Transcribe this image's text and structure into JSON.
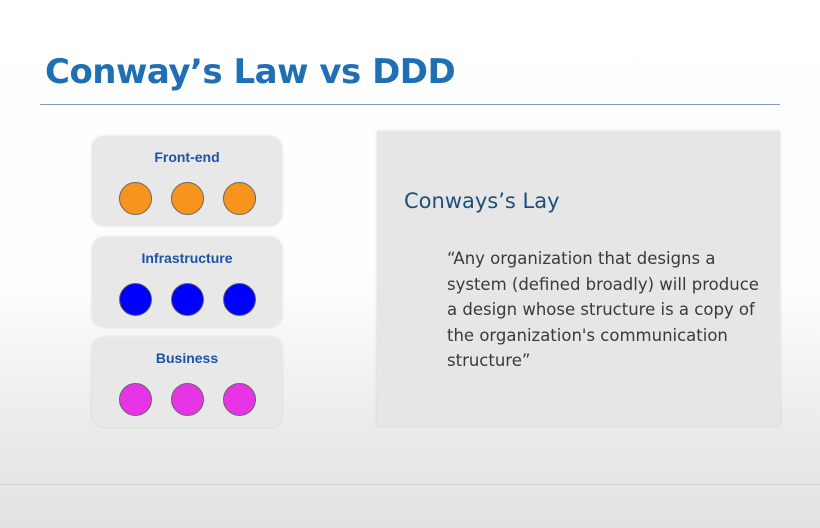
{
  "slide": {
    "title": "Conway’s Law vs DDD"
  },
  "teams": [
    {
      "label": "Front-end",
      "dot_color": "#f7941d",
      "dot_count": 3
    },
    {
      "label": "Infrastructure",
      "dot_color": "#0000ff",
      "dot_count": 3
    },
    {
      "label": "Business",
      "dot_color": "#e633e6",
      "dot_count": 3
    }
  ],
  "quote": {
    "heading": "Conways’s Lay",
    "text": "“Any organization that designs a\nsystem (defined broadly) will produce\na design whose structure is a copy of\nthe organization's communication\nstructure”"
  },
  "colors": {
    "title": "#1f6fb5",
    "team_label": "#1a54a6",
    "panel_bg": "#e8e8e8",
    "quote_bg": "#e6e6e6"
  }
}
